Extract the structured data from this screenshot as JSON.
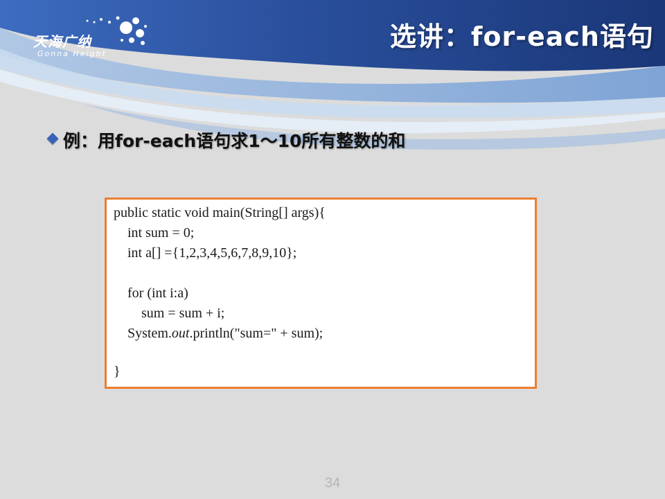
{
  "header": {
    "logo_name": "天海广纳",
    "logo_sub": "Gonna Height",
    "title": "选讲：for-each语句"
  },
  "bullet": {
    "text": "例：用for-each语句求1～10所有整数的和"
  },
  "code": {
    "lines": [
      "public static void main(String[] args){",
      "    int sum = 0;",
      "    int a[] ={1,2,3,4,5,6,7,8,9,10};",
      "",
      "    for (int i:a)",
      "        sum = sum + i;",
      "    System.",
      "",
      "}"
    ],
    "println_prefix": "    System.",
    "println_out": "out",
    "println_rest": ".println(\"sum=\" + sum);"
  },
  "footer": {
    "page_number": "34"
  },
  "colors": {
    "header_dark": "#1f3f86",
    "header_light": "#5b8fd0",
    "box_border": "#ed7d31",
    "background": "#dcdcdc"
  }
}
